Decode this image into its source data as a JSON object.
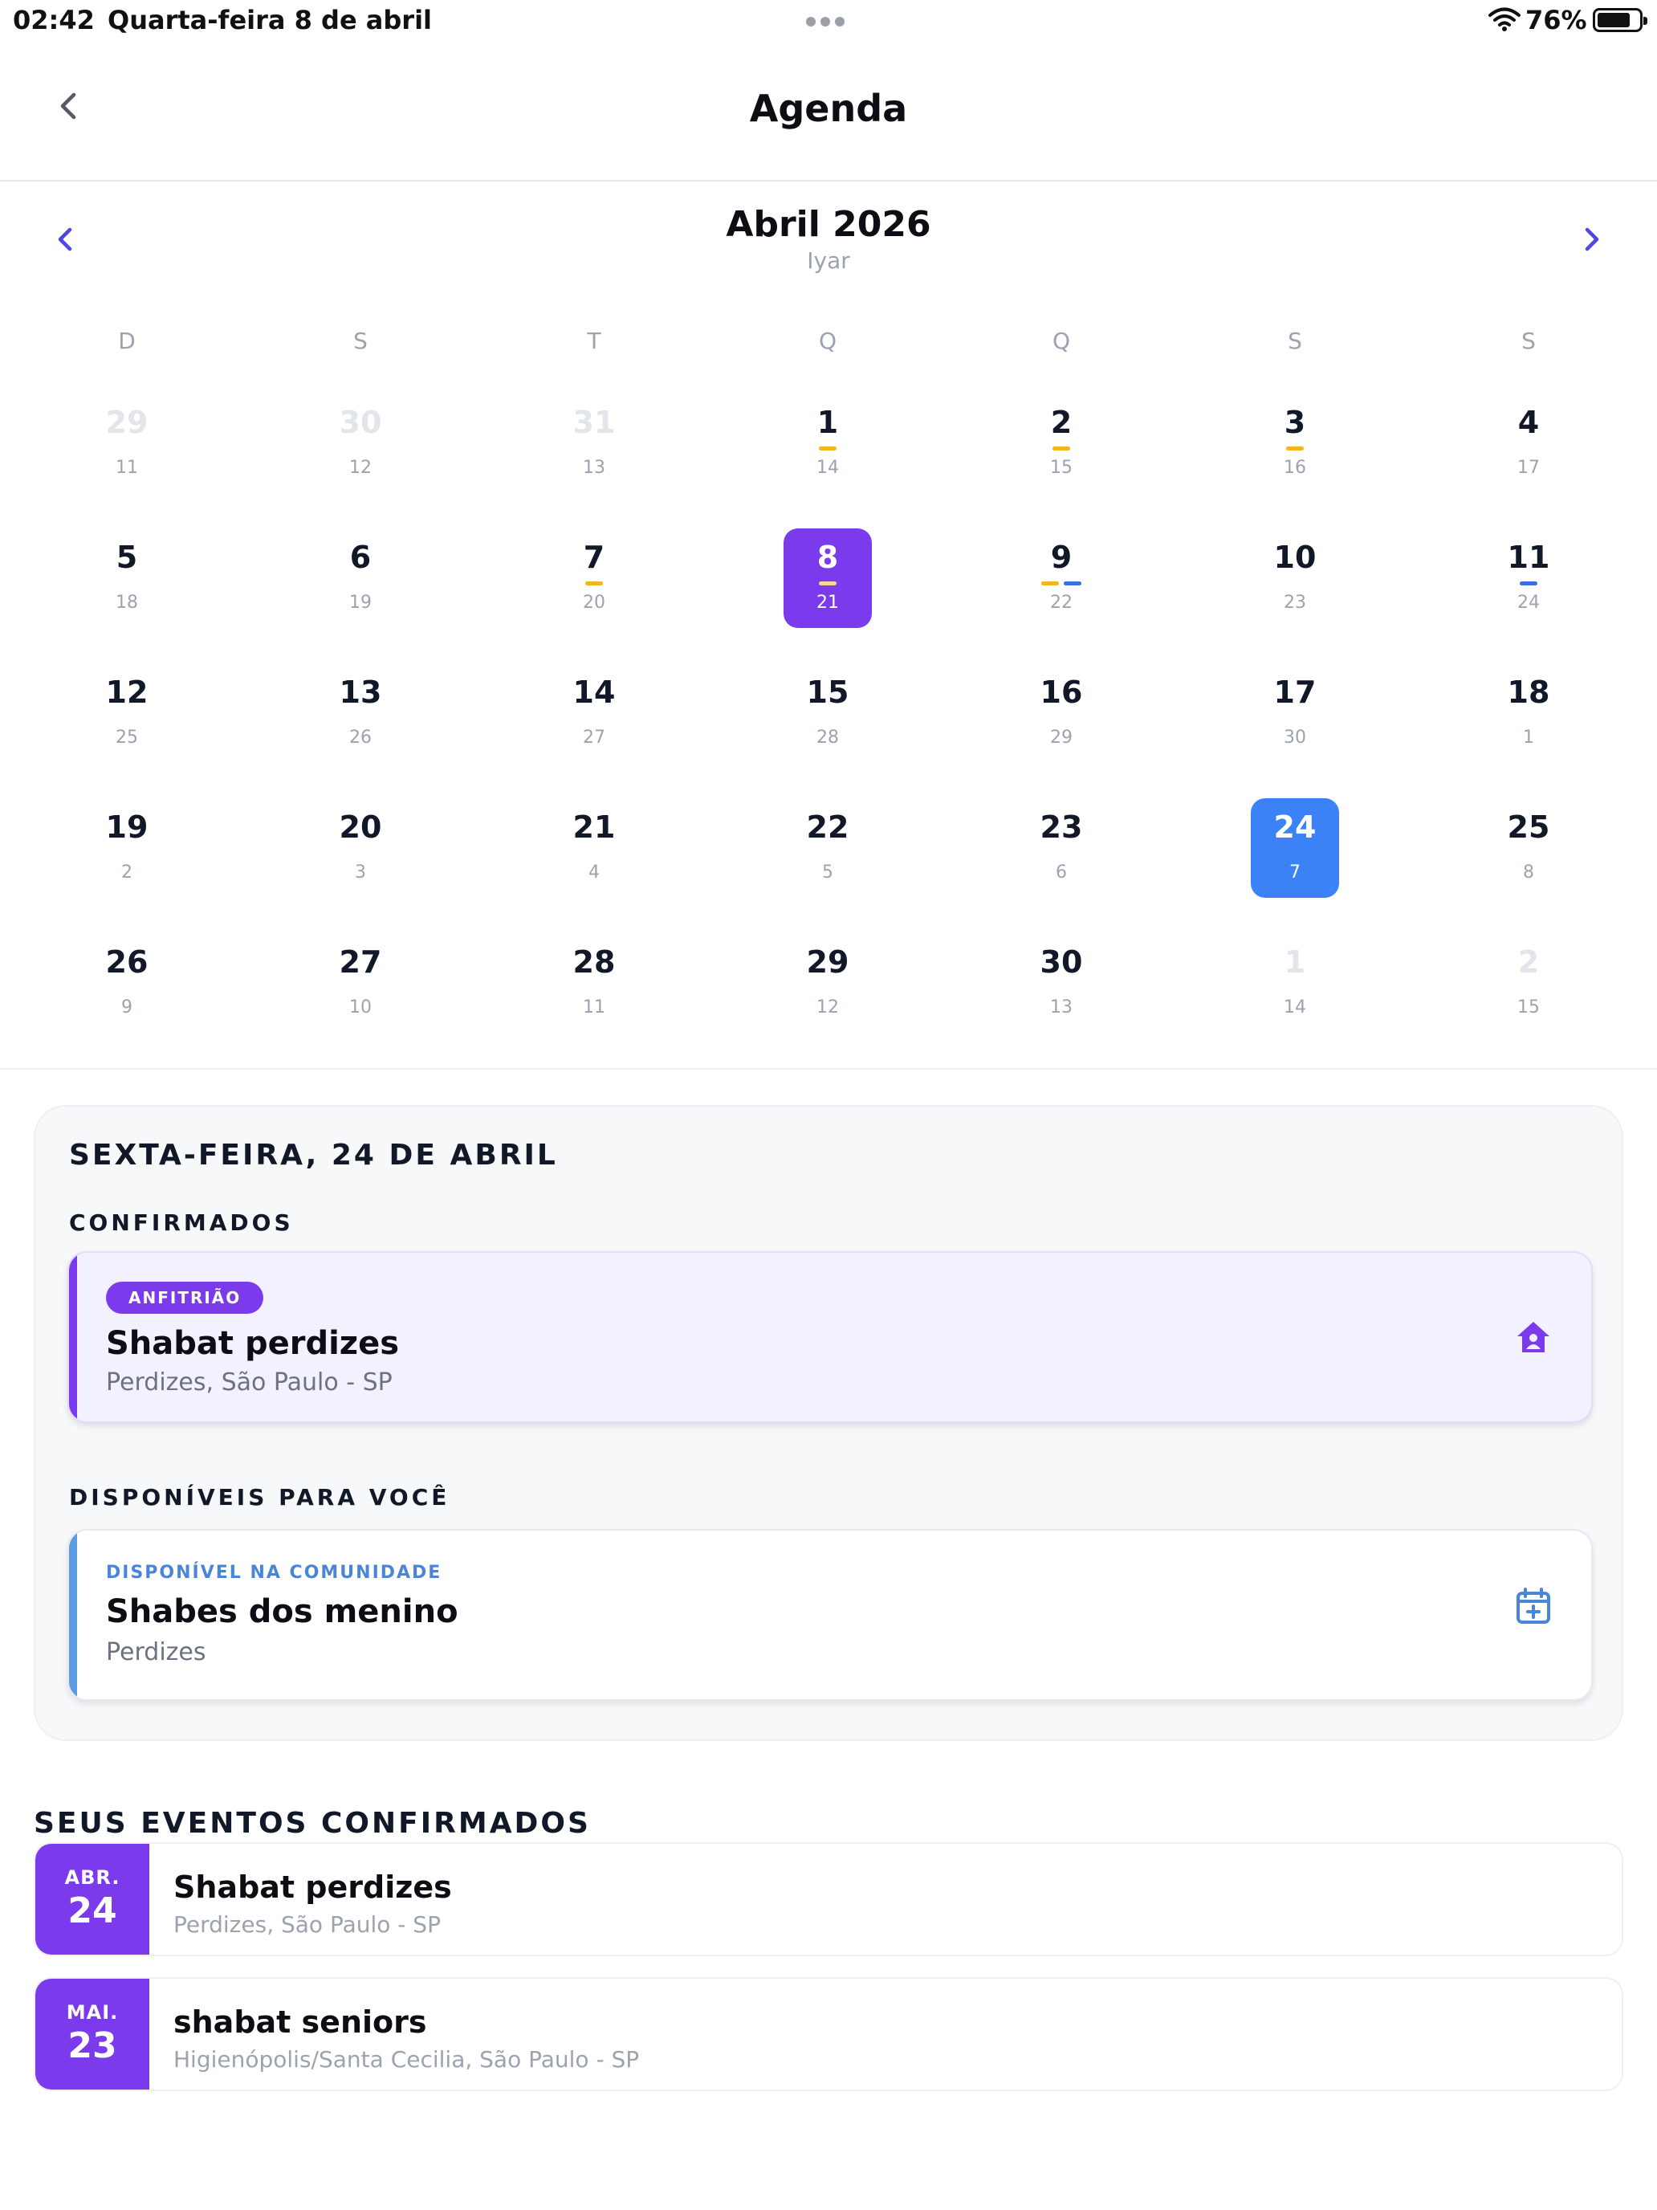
{
  "status_bar": {
    "time": "02:42",
    "date": "Quarta-feira 8 de abril",
    "battery": "76%"
  },
  "nav": {
    "title": "Agenda"
  },
  "calendar": {
    "month_title": "Abril 2026",
    "hebrew_month": "Iyar",
    "weekdays": [
      "D",
      "S",
      "T",
      "Q",
      "Q",
      "S",
      "S"
    ],
    "weeks": [
      [
        {
          "day": "29",
          "heb": "11",
          "muted": true
        },
        {
          "day": "30",
          "heb": "12",
          "muted": true
        },
        {
          "day": "31",
          "heb": "13",
          "muted": true
        },
        {
          "day": "1",
          "heb": "14",
          "marks": [
            "yellow"
          ]
        },
        {
          "day": "2",
          "heb": "15",
          "marks": [
            "yellow"
          ]
        },
        {
          "day": "3",
          "heb": "16",
          "marks": [
            "yellow"
          ]
        },
        {
          "day": "4",
          "heb": "17"
        }
      ],
      [
        {
          "day": "5",
          "heb": "18"
        },
        {
          "day": "6",
          "heb": "19"
        },
        {
          "day": "7",
          "heb": "20",
          "marks": [
            "yellow"
          ]
        },
        {
          "day": "8",
          "heb": "21",
          "today": true,
          "marks": [
            "white"
          ]
        },
        {
          "day": "9",
          "heb": "22",
          "marks": [
            "yellow",
            "blue"
          ]
        },
        {
          "day": "10",
          "heb": "23"
        },
        {
          "day": "11",
          "heb": "24",
          "marks": [
            "blue"
          ]
        }
      ],
      [
        {
          "day": "12",
          "heb": "25"
        },
        {
          "day": "13",
          "heb": "26"
        },
        {
          "day": "14",
          "heb": "27"
        },
        {
          "day": "15",
          "heb": "28"
        },
        {
          "day": "16",
          "heb": "29"
        },
        {
          "day": "17",
          "heb": "30"
        },
        {
          "day": "18",
          "heb": "1"
        }
      ],
      [
        {
          "day": "19",
          "heb": "2"
        },
        {
          "day": "20",
          "heb": "3"
        },
        {
          "day": "21",
          "heb": "4"
        },
        {
          "day": "22",
          "heb": "5"
        },
        {
          "day": "23",
          "heb": "6"
        },
        {
          "day": "24",
          "heb": "7",
          "selected": true
        },
        {
          "day": "25",
          "heb": "8"
        }
      ],
      [
        {
          "day": "26",
          "heb": "9"
        },
        {
          "day": "27",
          "heb": "10"
        },
        {
          "day": "28",
          "heb": "11"
        },
        {
          "day": "29",
          "heb": "12"
        },
        {
          "day": "30",
          "heb": "13"
        },
        {
          "day": "1",
          "heb": "14",
          "muted": true
        },
        {
          "day": "2",
          "heb": "15",
          "muted": true
        }
      ]
    ],
    "colors": {
      "today": "#7c3aed",
      "selected": "#3b82f6",
      "mark_yellow": "#f3b51c",
      "mark_blue": "#3b6ee0"
    }
  },
  "detail": {
    "date_heading": "SEXTA-FEIRA, 24 DE ABRIL",
    "confirmed_heading": "CONFIRMADOS",
    "host_card": {
      "badge": "ANFITRIÃO",
      "title": "Shabat perdizes",
      "subtitle": "Perdizes, São Paulo - SP",
      "icon": "home-icon"
    },
    "available_heading": "DISPONÍVEIS PARA VOCÊ",
    "available_card": {
      "tag": "DISPONÍVEL NA COMUNIDADE",
      "title": "Shabes dos menino",
      "subtitle": "Perdizes",
      "icon": "calendar-add-icon"
    }
  },
  "confirmed_events": {
    "heading": "SEUS EVENTOS CONFIRMADOS",
    "items": [
      {
        "month": "ABR.",
        "day": "24",
        "title": "Shabat perdizes",
        "subtitle": "Perdizes, São Paulo - SP"
      },
      {
        "month": "MAI.",
        "day": "23",
        "title": "shabat seniors",
        "subtitle": "Higienópolis/Santa Cecilia, São Paulo - SP"
      }
    ]
  }
}
